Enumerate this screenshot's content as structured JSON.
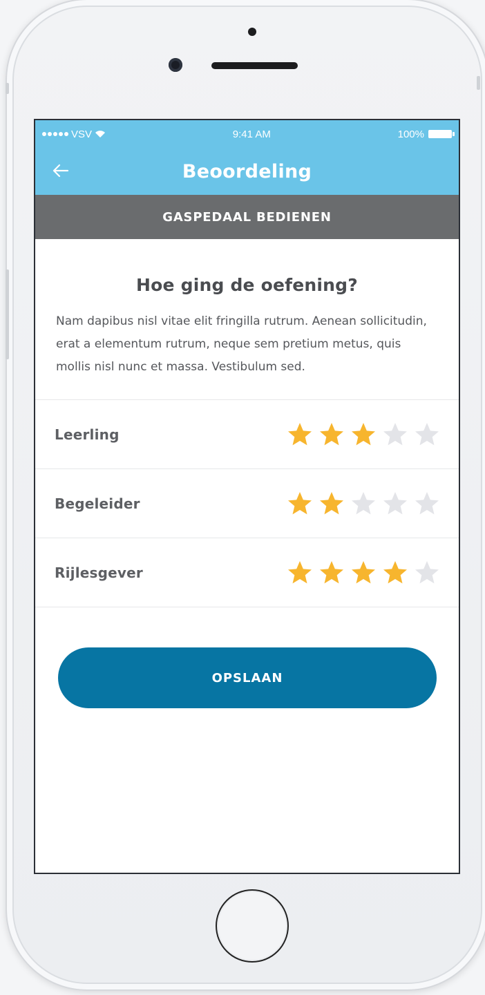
{
  "status_bar": {
    "carrier": "VSV",
    "time": "9:41 AM",
    "battery": "100%"
  },
  "nav": {
    "title": "Beoordeling",
    "back_icon": "arrow-left-icon"
  },
  "section": {
    "title": "GASPEDAAL BEDIENEN"
  },
  "main": {
    "question": "Hoe ging de oefening?",
    "description": "Nam dapibus nisl vitae elit fringilla rutrum. Aenean sollicitudin, erat a elementum rutrum, neque sem pretium metus, quis mollis nisl nunc et massa. Vestibulum sed."
  },
  "ratings": [
    {
      "label": "Leerling",
      "value": 3,
      "max": 5
    },
    {
      "label": "Begeleider",
      "value": 2,
      "max": 5
    },
    {
      "label": "Rijlesgever",
      "value": 4,
      "max": 5
    }
  ],
  "actions": {
    "save_label": "OPSLAAN"
  },
  "colors": {
    "header": "#6ac4e8",
    "subbar": "#6a6c6e",
    "star_filled": "#f7b52e",
    "star_empty": "#e3e4e8",
    "button": "#0775a3"
  }
}
